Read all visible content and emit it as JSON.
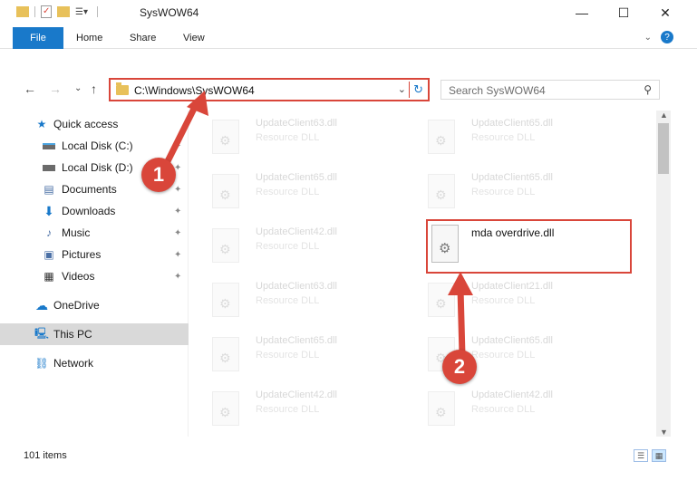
{
  "window": {
    "title": "SysWOW64",
    "controls": {
      "minimize": "—",
      "maximize": "☐",
      "close": "✕"
    }
  },
  "ribbon": {
    "tabs": [
      "File",
      "Home",
      "Share",
      "View"
    ],
    "expand_icon": "chevron-down-icon",
    "help_icon": "help-icon",
    "help_label": "?"
  },
  "navigation": {
    "back": "←",
    "forward": "→",
    "recent": "⌄",
    "up": "↑",
    "address": "C:\\Windows\\SysWOW64",
    "search_placeholder": "Search SysWOW64"
  },
  "sidebar": {
    "items": [
      {
        "label": "Quick access",
        "icon": "star-icon",
        "pinned": false
      },
      {
        "label": "Local Disk (C:)",
        "icon": "drive-icon",
        "pinned": true
      },
      {
        "label": "Local Disk (D:)",
        "icon": "drive-icon",
        "pinned": true
      },
      {
        "label": "Documents",
        "icon": "documents-icon",
        "pinned": true
      },
      {
        "label": "Downloads",
        "icon": "downloads-icon",
        "pinned": true
      },
      {
        "label": "Music",
        "icon": "music-icon",
        "pinned": true
      },
      {
        "label": "Pictures",
        "icon": "pictures-icon",
        "pinned": true
      },
      {
        "label": "Videos",
        "icon": "videos-icon",
        "pinned": true
      },
      {
        "label": "OneDrive",
        "icon": "onedrive-icon",
        "pinned": false
      },
      {
        "label": "This PC",
        "icon": "computer-icon",
        "pinned": false
      },
      {
        "label": "Network",
        "icon": "network-icon",
        "pinned": false
      }
    ]
  },
  "files": {
    "col1": [
      {
        "name": "UpdateClient63.dll",
        "type": "Resource DLL"
      },
      {
        "name": "UpdateClient65.dll",
        "type": "Resource DLL"
      },
      {
        "name": "UpdateClient42.dll",
        "type": "Resource DLL"
      },
      {
        "name": "UpdateClient63.dll",
        "type": "Resource DLL"
      },
      {
        "name": "UpdateClient65.dll",
        "type": "Resource DLL"
      },
      {
        "name": "UpdateClient42.dll",
        "type": "Resource DLL"
      }
    ],
    "col2": [
      {
        "name": "UpdateClient65.dll",
        "type": "Resource DLL"
      },
      {
        "name": "UpdateClient65.dll",
        "type": "Resource DLL"
      },
      {
        "name": "mda overdrive.dll",
        "type": ""
      },
      {
        "name": "UpdateClient21.dll",
        "type": "Resource DLL"
      },
      {
        "name": "UpdateClient65.dll",
        "type": "Resource DLL"
      },
      {
        "name": "UpdateClient42.dll",
        "type": "Resource DLL"
      }
    ],
    "highlighted_name": "mda overdrive.dll"
  },
  "status": {
    "item_count": "101 items"
  },
  "callouts": {
    "one": "1",
    "two": "2"
  },
  "colors": {
    "accent": "#1979ca",
    "callout": "#d9463a"
  }
}
